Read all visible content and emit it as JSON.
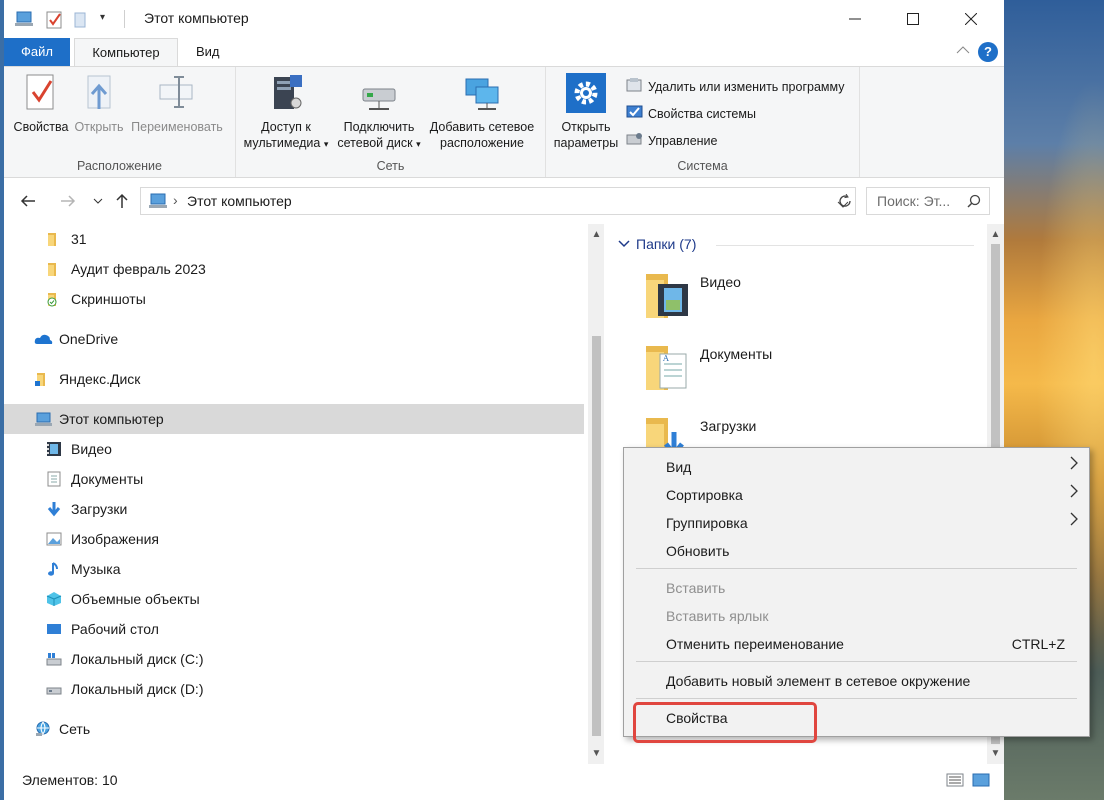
{
  "window": {
    "title": "Этот компьютер",
    "controls": [
      "minimize",
      "maximize",
      "close"
    ]
  },
  "ribbon_tabs": {
    "file": "Файл",
    "computer": "Компьютер",
    "view": "Вид"
  },
  "ribbon": {
    "groups": {
      "location": {
        "label": "Расположение",
        "properties": "Свойства",
        "open": "Открыть",
        "rename": "Переименовать"
      },
      "network": {
        "label": "Сеть",
        "media_access": [
          "Доступ к",
          "мультимедиа"
        ],
        "map_drive": [
          "Подключить",
          "сетевой диск"
        ],
        "add_location": [
          "Добавить сетевое",
          "расположение"
        ]
      },
      "system": {
        "label": "Система",
        "open_settings": [
          "Открыть",
          "параметры"
        ],
        "uninstall": "Удалить или изменить программу",
        "system_properties": "Свойства системы",
        "manage": "Управление"
      }
    }
  },
  "address": {
    "path": "Этот компьютер",
    "search_placeholder": "Поиск: Эт..."
  },
  "nav": {
    "items": [
      {
        "label": "31",
        "icon": "folder-icon"
      },
      {
        "label": "Аудит февраль 2023",
        "icon": "folder-icon"
      },
      {
        "label": "Скриншоты",
        "icon": "folder-synced-icon"
      },
      {
        "label": "OneDrive",
        "icon": "cloud-icon"
      },
      {
        "label": "Яндекс.Диск",
        "icon": "yandex-disk-icon"
      },
      {
        "label": "Этот компьютер",
        "icon": "computer-icon"
      },
      {
        "label": "Видео",
        "icon": "video-icon"
      },
      {
        "label": "Документы",
        "icon": "documents-icon"
      },
      {
        "label": "Загрузки",
        "icon": "download-icon"
      },
      {
        "label": "Изображения",
        "icon": "pictures-icon"
      },
      {
        "label": "Музыка",
        "icon": "music-icon"
      },
      {
        "label": "Объемные объекты",
        "icon": "3d-objects-icon"
      },
      {
        "label": "Рабочий стол",
        "icon": "desktop-icon"
      },
      {
        "label": "Локальный диск (C:)",
        "icon": "drive-c-icon"
      },
      {
        "label": "Локальный диск (D:)",
        "icon": "drive-d-icon"
      },
      {
        "label": "Сеть",
        "icon": "network-icon"
      }
    ]
  },
  "content": {
    "group_header": "Папки (7)",
    "folders": [
      {
        "label": "Видео",
        "icon": "video-folder-icon"
      },
      {
        "label": "Документы",
        "icon": "documents-folder-icon"
      },
      {
        "label": "Загрузки",
        "icon": "downloads-folder-icon"
      }
    ]
  },
  "context_menu": {
    "items": [
      {
        "label": "Вид",
        "submenu": true,
        "enabled": true
      },
      {
        "label": "Сортировка",
        "submenu": true,
        "enabled": true
      },
      {
        "label": "Группировка",
        "submenu": true,
        "enabled": true
      },
      {
        "label": "Обновить",
        "enabled": true
      },
      {
        "label": "Вставить",
        "enabled": false
      },
      {
        "label": "Вставить ярлык",
        "enabled": false
      },
      {
        "label": "Отменить переименование",
        "shortcut": "CTRL+Z",
        "enabled": true
      },
      {
        "label": "Добавить новый элемент в сетевое окружение",
        "enabled": true
      },
      {
        "label": "Свойства",
        "enabled": true,
        "highlighted": true
      }
    ]
  },
  "status": {
    "count": "Элементов: 10"
  },
  "colors": {
    "accent": "#1e6fc8",
    "highlight": "#e0463f",
    "selected": "#d9d9d9"
  }
}
